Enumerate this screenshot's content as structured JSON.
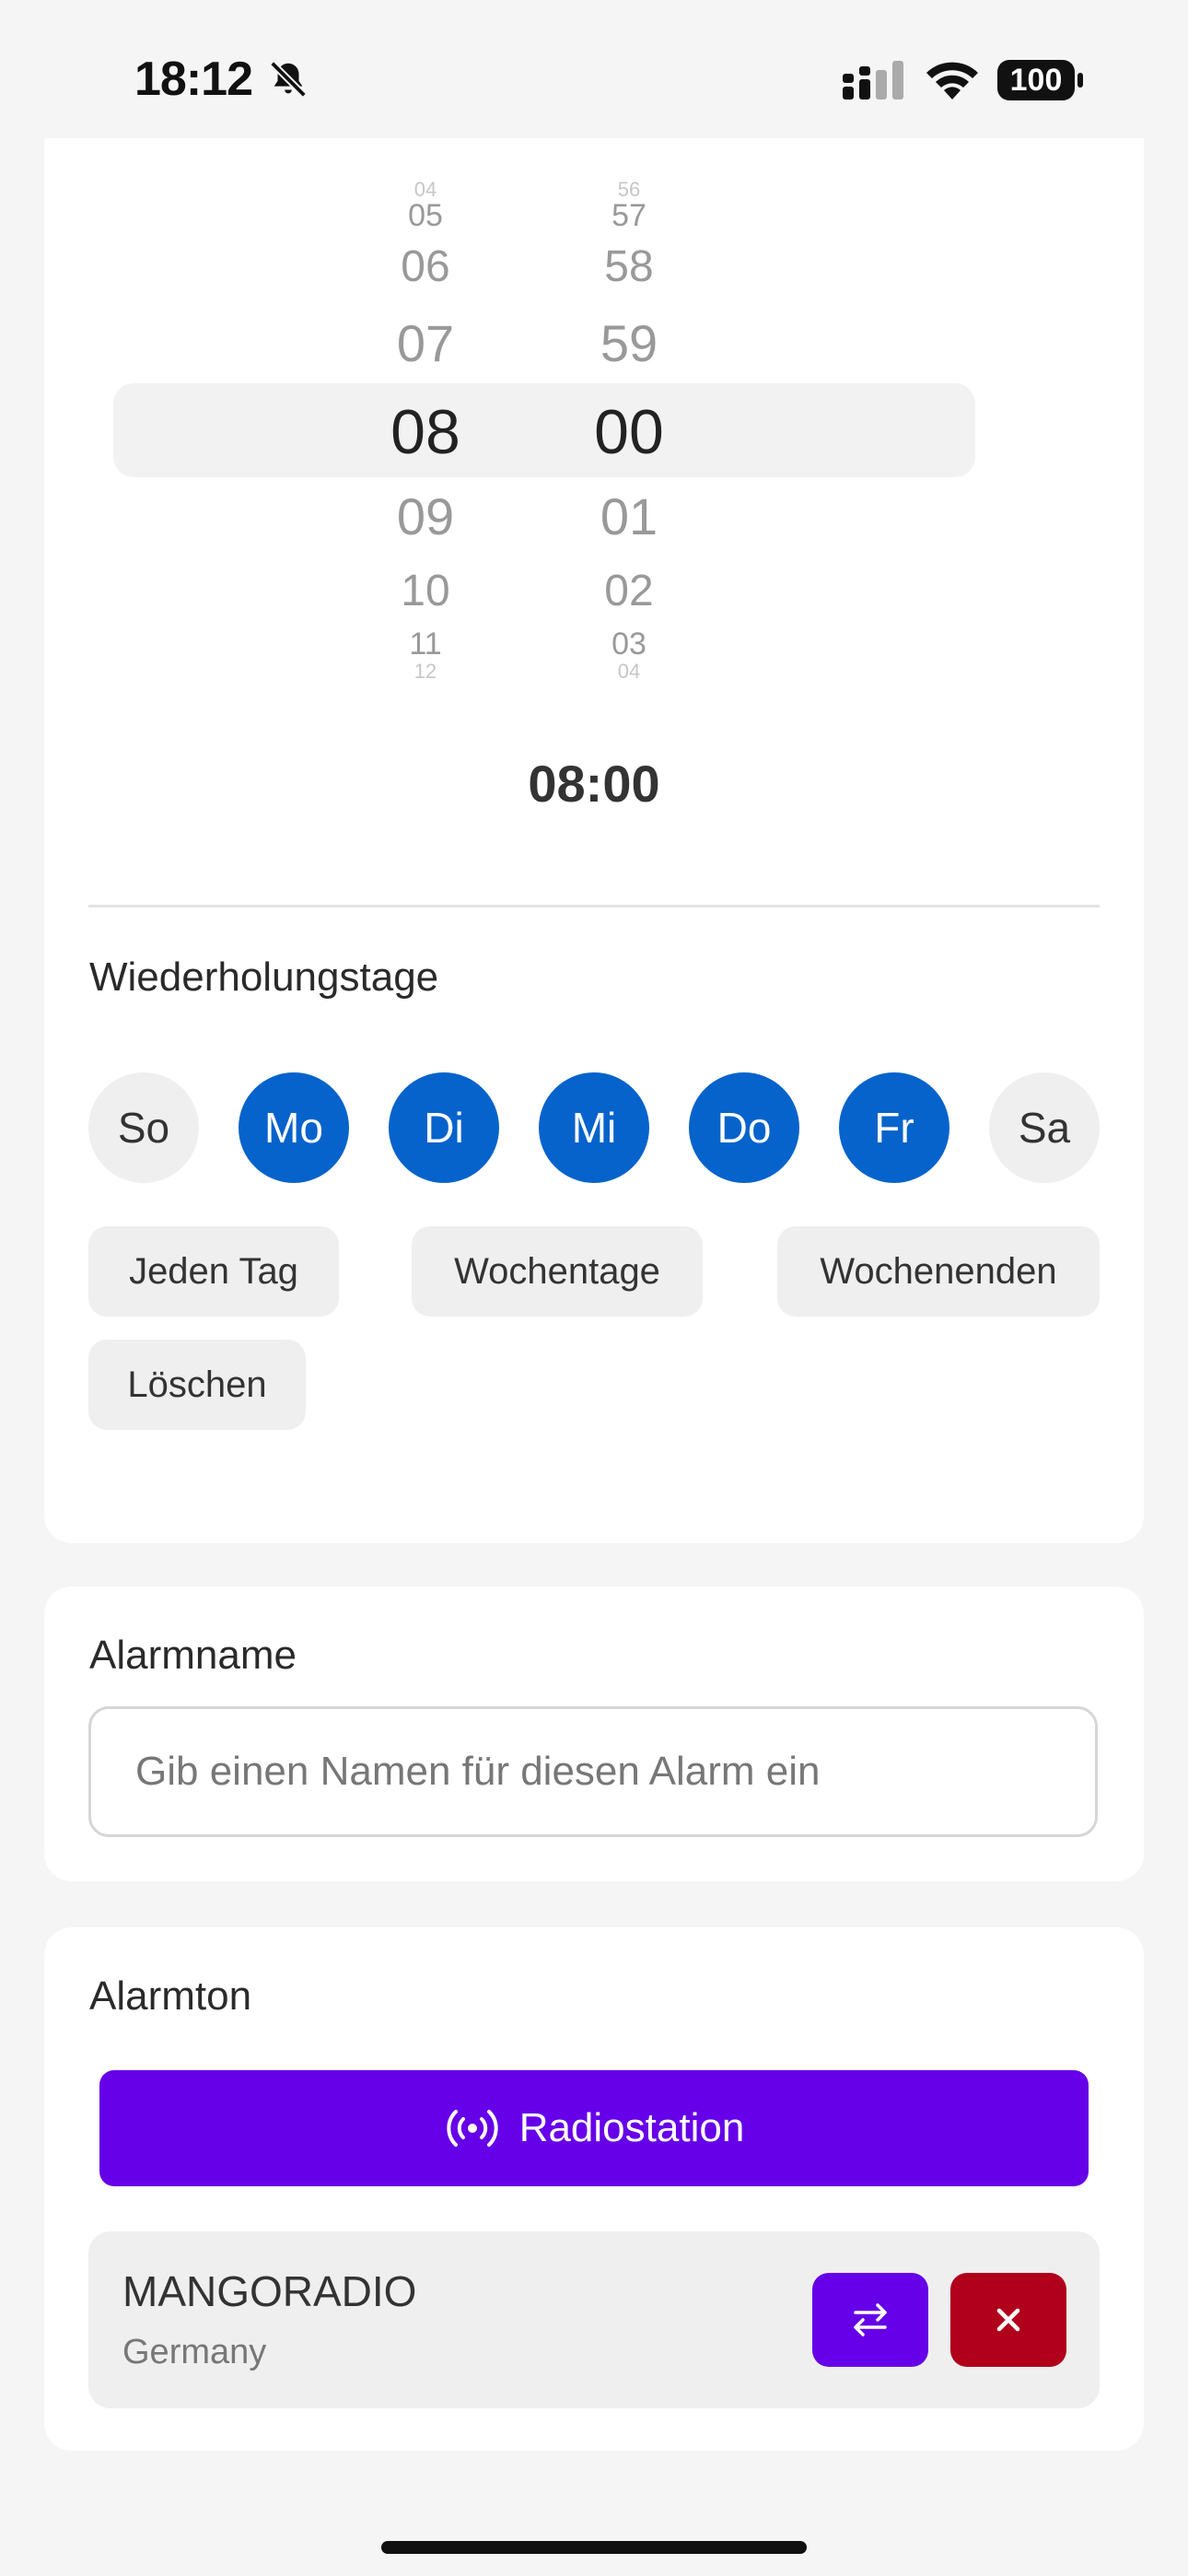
{
  "status_bar": {
    "time": "18:12",
    "battery": "100",
    "icons": [
      "bell-muted-icon",
      "cellular-signal-icon",
      "wifi-icon",
      "battery-icon"
    ]
  },
  "picker": {
    "hours": [
      "04",
      "05",
      "06",
      "07",
      "08",
      "09",
      "10",
      "11",
      "12"
    ],
    "minutes": [
      "56",
      "57",
      "58",
      "59",
      "00",
      "01",
      "02",
      "03",
      "04"
    ],
    "selected_hour": "08",
    "selected_minute": "00",
    "display_time": "08:00"
  },
  "repeat": {
    "title": "Wiederholungstage",
    "days": [
      {
        "label": "So",
        "selected": false
      },
      {
        "label": "Mo",
        "selected": true
      },
      {
        "label": "Di",
        "selected": true
      },
      {
        "label": "Mi",
        "selected": true
      },
      {
        "label": "Do",
        "selected": true
      },
      {
        "label": "Fr",
        "selected": true
      },
      {
        "label": "Sa",
        "selected": false
      }
    ],
    "presets": [
      "Jeden Tag",
      "Wochentage",
      "Wochenenden",
      "Löschen"
    ]
  },
  "alarm_name": {
    "title": "Alarmname",
    "placeholder": "Gib einen Namen für diesen Alarm ein",
    "value": ""
  },
  "alarm_sound": {
    "title": "Alarmton",
    "radio_button": "Radiostation",
    "station": {
      "name": "MANGORADIO",
      "country": "Germany"
    }
  },
  "colors": {
    "accent_blue": "#0663cb",
    "accent_purple": "#6600e8",
    "danger_red": "#b0001c"
  }
}
